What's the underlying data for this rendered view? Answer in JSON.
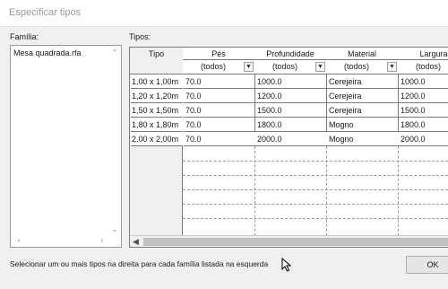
{
  "window": {
    "title": "Especificar tipos"
  },
  "family": {
    "label": "Família:",
    "items": [
      "Mesa quadrada.rfa"
    ]
  },
  "types": {
    "label": "Tipos:",
    "columns": [
      "Tipo",
      "Pés",
      "Profundidade",
      "Material",
      "Largura"
    ],
    "filter_value": "(todos)",
    "rows": [
      {
        "tipo": "1,00 x 1,00m",
        "pes": "70.0",
        "profundidade": "1000.0",
        "material": "Cerejeira",
        "largura": "1000.0"
      },
      {
        "tipo": "1,20 x 1,20m",
        "pes": "70.0",
        "profundidade": "1200.0",
        "material": "Cerejeira",
        "largura": "1200.0"
      },
      {
        "tipo": "1,50 x 1,50m",
        "pes": "70.0",
        "profundidade": "1500.0",
        "material": "Cerejeira",
        "largura": "1500.0"
      },
      {
        "tipo": "1,80 x 1,80m",
        "pes": "70.0",
        "profundidade": "1800.0",
        "material": "Mogno",
        "largura": "1800.0"
      },
      {
        "tipo": "2,00 x 2,00m",
        "pes": "70.0",
        "profundidade": "2000.0",
        "material": "Mogno",
        "largura": "2000.0"
      }
    ]
  },
  "status": {
    "text": "Selecionar um ou mais tipos na direita para cada família listada na esquerda"
  },
  "buttons": {
    "ok": "OK"
  }
}
